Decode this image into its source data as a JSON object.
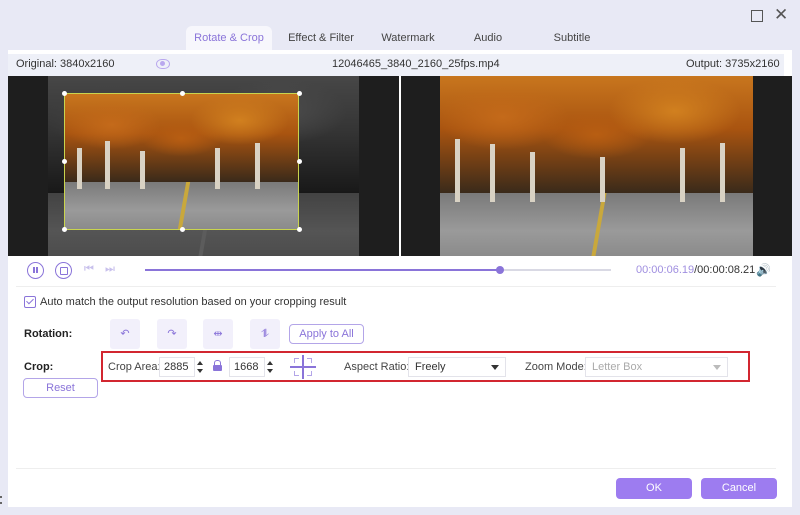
{
  "window": {
    "maximize_icon": "maximize-icon",
    "close_icon": "close-icon",
    "close_glyph": "✕"
  },
  "tabs": [
    {
      "label": "Rotate & Crop",
      "active": true
    },
    {
      "label": "Effect & Filter",
      "active": false
    },
    {
      "label": "Watermark",
      "active": false
    },
    {
      "label": "Audio",
      "active": false
    },
    {
      "label": "Subtitle",
      "active": false
    }
  ],
  "infobar": {
    "original": "Original: 3840x2160",
    "filename": "12046465_3840_2160_25fps.mp4",
    "output": "Output: 3735x2160",
    "preview_icon": "eye-icon"
  },
  "player": {
    "current_time": "00:00:06.19",
    "total_time": "/00:00:08.21",
    "progress": 0.762,
    "prev_glyph": "⏮",
    "next_glyph": "⏭",
    "volume_glyph": "🔊"
  },
  "auto_match": {
    "label": "Auto match the output resolution based on your cropping result",
    "checked": true
  },
  "rotation": {
    "label": "Rotation:",
    "buttons": [
      {
        "name": "rotate-left",
        "glyph": "↶"
      },
      {
        "name": "rotate-right",
        "glyph": "↷"
      },
      {
        "name": "flip-horizontal",
        "glyph": "⇹"
      },
      {
        "name": "flip-vertical",
        "glyph": "⥮"
      }
    ],
    "apply_all": "Apply to All"
  },
  "crop": {
    "label": "Crop:",
    "area_label": "Crop Area:",
    "width": "2885",
    "height": "1668",
    "aspect_label": "Aspect Ratio:",
    "aspect_value": "Freely",
    "zoom_label": "Zoom Mode:",
    "zoom_value": "Letter Box",
    "reset": "Reset"
  },
  "footer": {
    "ok": "OK",
    "cancel": "Cancel"
  },
  "colors": {
    "accent": "#8a74d9",
    "button_fill": "#9d7cf0",
    "highlight": "#d22630",
    "crop_frame": "#c9d44e"
  }
}
